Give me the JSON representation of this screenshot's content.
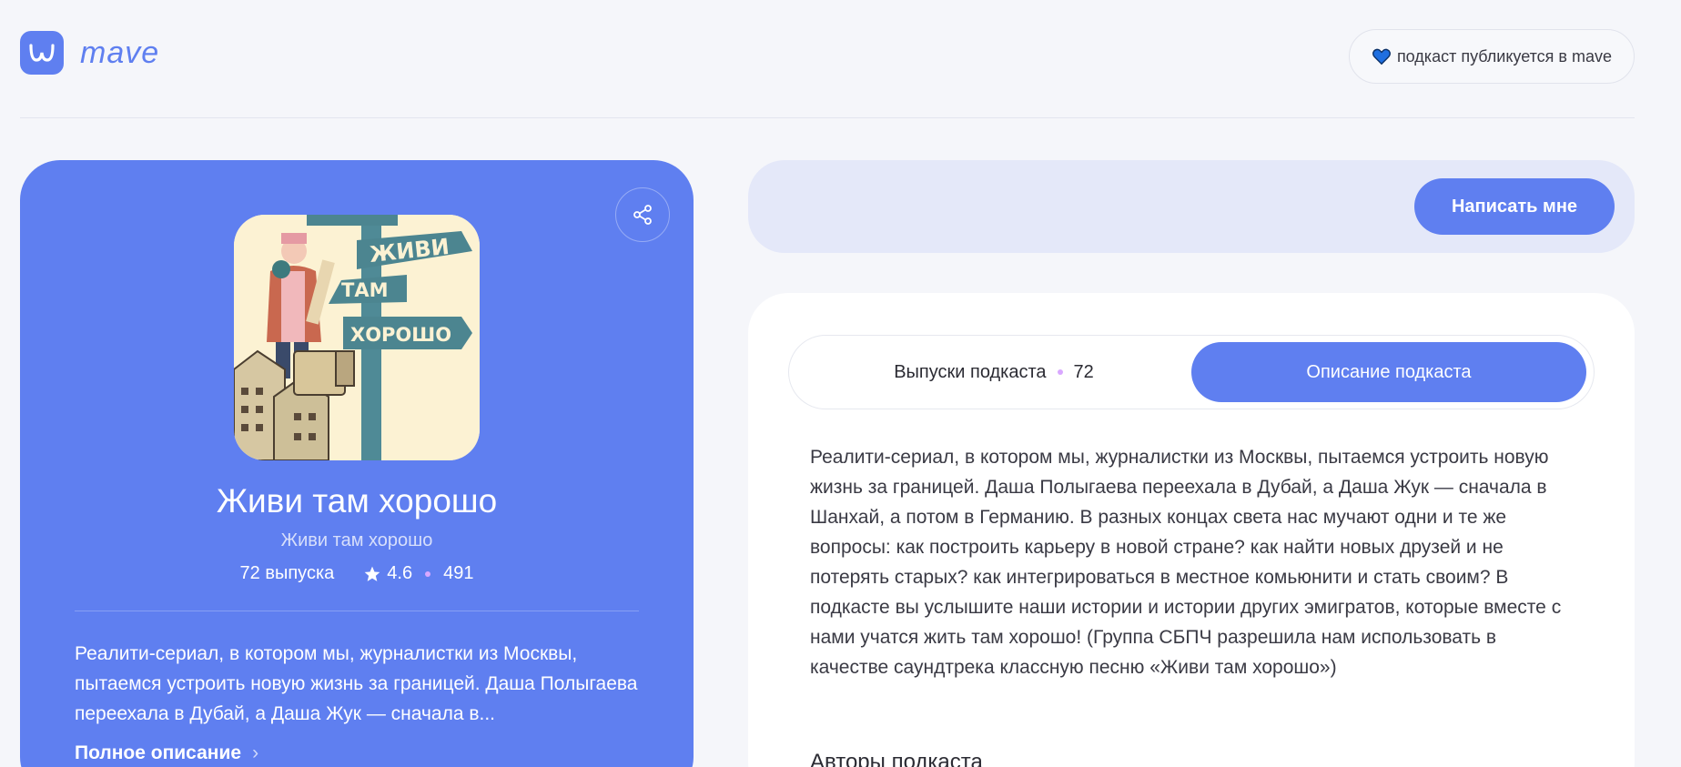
{
  "header": {
    "logo_text": "mave",
    "badge_label": "подкаст публикуется в mave"
  },
  "podcast": {
    "title": "Живи там хорошо",
    "author": "Живи там хорошо",
    "episodes_label": "72 выпуска",
    "rating": "4.6",
    "ratings_count": "491",
    "short_description": "Реалити-сериал, в котором мы, журналистки из Москвы, пытаемся устроить новую жизнь за границей. Даша Полыгаева переехала в Дубай, а Даша Жук — сначала в...",
    "full_description_link": "Полное описание",
    "cover_words": [
      "ЖИВИ",
      "ТАМ",
      "ХОРОШО"
    ]
  },
  "contact": {
    "button_label": "Написать мне"
  },
  "tabs": [
    {
      "label": "Выпуски подкаста",
      "count": "72",
      "active": false
    },
    {
      "label": "Описание подкаста",
      "active": true
    }
  ],
  "description": "Реалити-сериал, в котором мы, журналистки из Москвы, пытаемся устроить новую жизнь за границей. Даша Полыгаева переехала в Дубай, а Даша Жук — сначала в Шанхай, а потом в Германию. В разных концах света нас мучают одни и те же вопросы: как построить карьеру в новой стране? как найти новых друзей и не потерять старых? как интегрироваться в местное комьюнити и стать своим? В подкасте вы услышите наши истории и истории других эмигратов, которые вместе с нами учатся жить там хорошо! (Группа СБПЧ разрешила нам использовать в качестве саундтрека классную песню «Живи там хорошо»)",
  "authors_title": "Авторы подкаста",
  "colors": {
    "accent": "#5f7ff0",
    "background": "#f5f6fa",
    "dot": "#d9a8ff"
  },
  "icons": [
    "logo-icon",
    "heart-icon",
    "share-icon",
    "star-icon",
    "chevron-right-icon"
  ]
}
